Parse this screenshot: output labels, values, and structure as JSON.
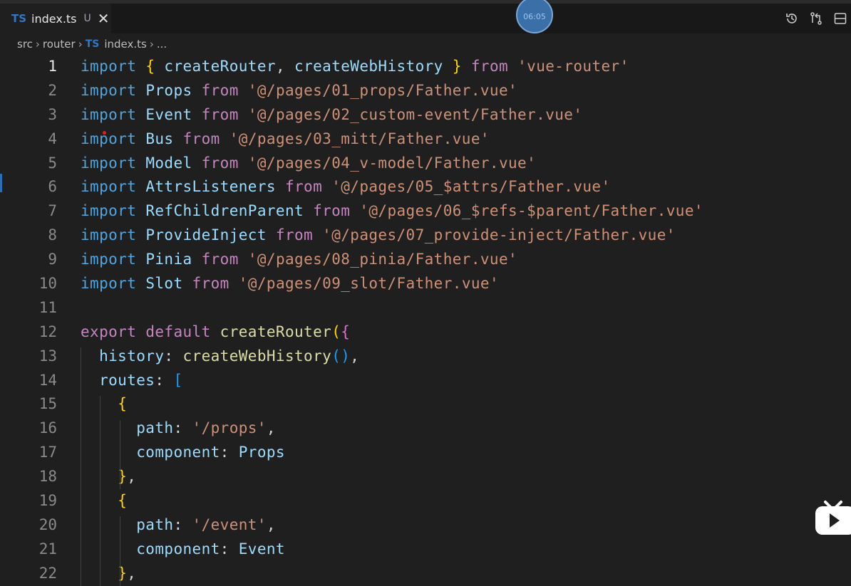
{
  "tab": {
    "lang_badge": "TS",
    "filename": "index.ts",
    "status": "U",
    "close_glyph": "✕"
  },
  "timer": "06:05",
  "breadcrumb": {
    "parts": [
      "src",
      "router"
    ],
    "ts_badge": "TS",
    "file": "index.ts",
    "tail": "..."
  },
  "colors": {
    "background": "#1f1f1f",
    "keyword": "#569cd6",
    "string": "#ce9178",
    "function": "#dcdcaa",
    "variable": "#9cdcfe"
  },
  "icons": [
    "timeline-icon",
    "compare-changes-icon",
    "split-editor-icon",
    "bilibili-play-icon"
  ],
  "active_line": 1,
  "lines": [
    {
      "n": "1",
      "tokens": [
        [
          "kw",
          "import"
        ],
        [
          "pl",
          " "
        ],
        [
          "p1",
          "{"
        ],
        [
          "pl",
          " "
        ],
        [
          "id",
          "createRouter"
        ],
        [
          "pl",
          ", "
        ],
        [
          "id",
          "createWebHistory"
        ],
        [
          "pl",
          " "
        ],
        [
          "p1",
          "}"
        ],
        [
          "pl",
          " "
        ],
        [
          "kp",
          "from"
        ],
        [
          "pl",
          " "
        ],
        [
          "str",
          "'vue-router'"
        ]
      ]
    },
    {
      "n": "2",
      "tokens": [
        [
          "kw",
          "import"
        ],
        [
          "pl",
          " "
        ],
        [
          "id",
          "Props"
        ],
        [
          "pl",
          " "
        ],
        [
          "kp",
          "from"
        ],
        [
          "pl",
          " "
        ],
        [
          "str",
          "'@/pages/01_props/Father.vue'"
        ]
      ]
    },
    {
      "n": "3",
      "tokens": [
        [
          "kw",
          "import"
        ],
        [
          "pl",
          " "
        ],
        [
          "id",
          "Event"
        ],
        [
          "pl",
          " "
        ],
        [
          "kp",
          "from"
        ],
        [
          "pl",
          " "
        ],
        [
          "str",
          "'@/pages/02_custom-event/Father.vue'"
        ]
      ]
    },
    {
      "n": "4",
      "tokens": [
        [
          "kw",
          "import"
        ],
        [
          "pl",
          " "
        ],
        [
          "id",
          "Bus"
        ],
        [
          "pl",
          " "
        ],
        [
          "kp",
          "from"
        ],
        [
          "pl",
          " "
        ],
        [
          "str",
          "'@/pages/03_mitt/Father.vue'"
        ]
      ]
    },
    {
      "n": "5",
      "tokens": [
        [
          "kw",
          "import"
        ],
        [
          "pl",
          " "
        ],
        [
          "id",
          "Model"
        ],
        [
          "pl",
          " "
        ],
        [
          "kp",
          "from"
        ],
        [
          "pl",
          " "
        ],
        [
          "str",
          "'@/pages/04_v-model/Father.vue'"
        ]
      ]
    },
    {
      "n": "6",
      "tokens": [
        [
          "kw",
          "import"
        ],
        [
          "pl",
          " "
        ],
        [
          "id",
          "AttrsListeners"
        ],
        [
          "pl",
          " "
        ],
        [
          "kp",
          "from"
        ],
        [
          "pl",
          " "
        ],
        [
          "str",
          "'@/pages/05_$attrs/Father.vue'"
        ]
      ]
    },
    {
      "n": "7",
      "tokens": [
        [
          "kw",
          "import"
        ],
        [
          "pl",
          " "
        ],
        [
          "id",
          "RefChildrenParent"
        ],
        [
          "pl",
          " "
        ],
        [
          "kp",
          "from"
        ],
        [
          "pl",
          " "
        ],
        [
          "str",
          "'@/pages/06_$refs-$parent/Father.vue'"
        ]
      ]
    },
    {
      "n": "8",
      "tokens": [
        [
          "kw",
          "import"
        ],
        [
          "pl",
          " "
        ],
        [
          "id",
          "ProvideInject"
        ],
        [
          "pl",
          " "
        ],
        [
          "kp",
          "from"
        ],
        [
          "pl",
          " "
        ],
        [
          "str",
          "'@/pages/07_provide-inject/Father.vue'"
        ]
      ]
    },
    {
      "n": "9",
      "tokens": [
        [
          "kw",
          "import"
        ],
        [
          "pl",
          " "
        ],
        [
          "id",
          "Pinia"
        ],
        [
          "pl",
          " "
        ],
        [
          "kp",
          "from"
        ],
        [
          "pl",
          " "
        ],
        [
          "str",
          "'@/pages/08_pinia/Father.vue'"
        ]
      ]
    },
    {
      "n": "10",
      "tokens": [
        [
          "kw",
          "import"
        ],
        [
          "pl",
          " "
        ],
        [
          "id",
          "Slot"
        ],
        [
          "pl",
          " "
        ],
        [
          "kp",
          "from"
        ],
        [
          "pl",
          " "
        ],
        [
          "str",
          "'@/pages/09_slot/Father.vue'"
        ]
      ]
    },
    {
      "n": "11",
      "tokens": []
    },
    {
      "n": "12",
      "tokens": [
        [
          "kp",
          "export"
        ],
        [
          "pl",
          " "
        ],
        [
          "kp",
          "default"
        ],
        [
          "pl",
          " "
        ],
        [
          "fn",
          "createRouter"
        ],
        [
          "p1",
          "("
        ],
        [
          "p2",
          "{"
        ]
      ]
    },
    {
      "n": "13",
      "tokens": [
        [
          "pl",
          "  "
        ],
        [
          "id",
          "history"
        ],
        [
          "pl",
          ": "
        ],
        [
          "fn",
          "createWebHistory"
        ],
        [
          "p3",
          "()"
        ],
        [
          "pl",
          ","
        ]
      ]
    },
    {
      "n": "14",
      "tokens": [
        [
          "pl",
          "  "
        ],
        [
          "id",
          "routes"
        ],
        [
          "pl",
          ": "
        ],
        [
          "p3",
          "["
        ]
      ]
    },
    {
      "n": "15",
      "tokens": [
        [
          "pl",
          "    "
        ],
        [
          "p1",
          "{"
        ]
      ]
    },
    {
      "n": "16",
      "tokens": [
        [
          "pl",
          "      "
        ],
        [
          "id",
          "path"
        ],
        [
          "pl",
          ": "
        ],
        [
          "str",
          "'/props'"
        ],
        [
          "pl",
          ","
        ]
      ]
    },
    {
      "n": "17",
      "tokens": [
        [
          "pl",
          "      "
        ],
        [
          "id",
          "component"
        ],
        [
          "pl",
          ": "
        ],
        [
          "id",
          "Props"
        ]
      ]
    },
    {
      "n": "18",
      "tokens": [
        [
          "pl",
          "    "
        ],
        [
          "p1",
          "}"
        ],
        [
          "pl",
          ","
        ]
      ]
    },
    {
      "n": "19",
      "tokens": [
        [
          "pl",
          "    "
        ],
        [
          "p1",
          "{"
        ]
      ]
    },
    {
      "n": "20",
      "tokens": [
        [
          "pl",
          "      "
        ],
        [
          "id",
          "path"
        ],
        [
          "pl",
          ": "
        ],
        [
          "str",
          "'/event'"
        ],
        [
          "pl",
          ","
        ]
      ]
    },
    {
      "n": "21",
      "tokens": [
        [
          "pl",
          "      "
        ],
        [
          "id",
          "component"
        ],
        [
          "pl",
          ": "
        ],
        [
          "id",
          "Event"
        ]
      ]
    },
    {
      "n": "22",
      "tokens": [
        [
          "pl",
          "    "
        ],
        [
          "p1",
          "}"
        ],
        [
          "pl",
          ","
        ]
      ]
    }
  ]
}
